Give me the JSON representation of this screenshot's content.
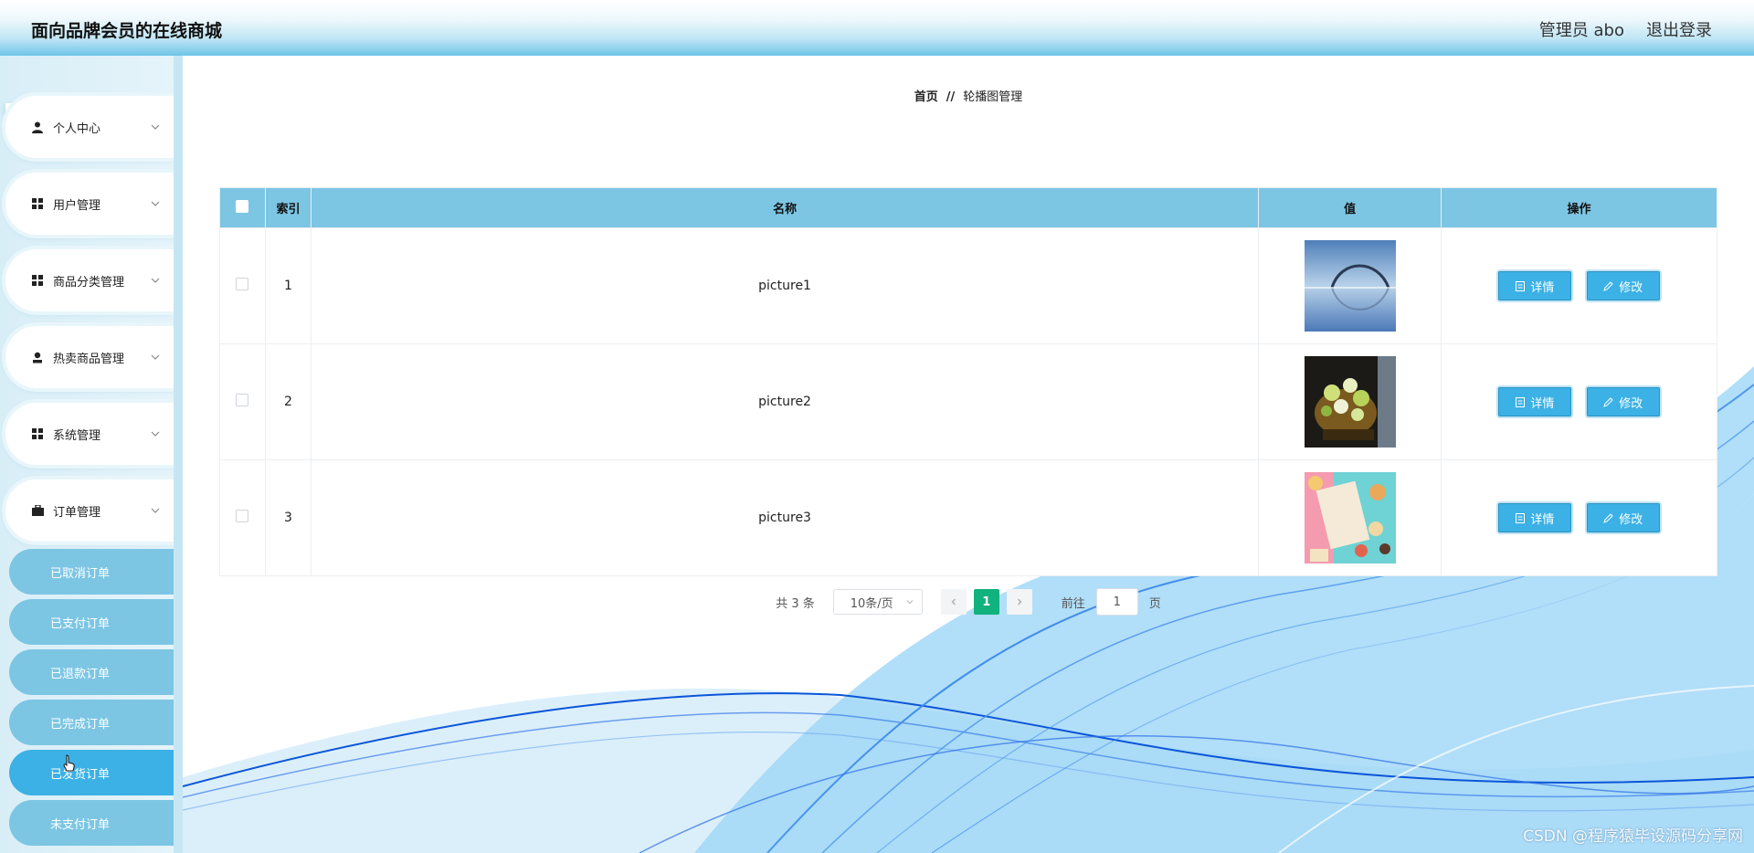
{
  "header": {
    "title": "面向品牌会员的在线商城",
    "admin": "管理员 abo",
    "logout": "退出登录"
  },
  "sidebar": {
    "items": [
      {
        "label": "个人中心",
        "icon": "person-icon"
      },
      {
        "label": "用户管理",
        "icon": "grid-icon"
      },
      {
        "label": "商品分类管理",
        "icon": "grid-icon"
      },
      {
        "label": "热卖商品管理",
        "icon": "user-icon"
      },
      {
        "label": "系统管理",
        "icon": "grid-icon"
      },
      {
        "label": "订单管理",
        "icon": "briefcase-icon"
      }
    ],
    "subitems": [
      "已取消订单",
      "已支付订单",
      "已退款订单",
      "已完成订单",
      "已发货订单",
      "未支付订单"
    ]
  },
  "breadcrumb": {
    "home": "首页",
    "sep": "//",
    "current": "轮播图管理"
  },
  "table": {
    "headers": {
      "index": "索引",
      "name": "名称",
      "value": "值",
      "action": "操作"
    },
    "rows": [
      {
        "index": "1",
        "name": "picture1",
        "detail": "详情",
        "edit": "修改"
      },
      {
        "index": "2",
        "name": "picture2",
        "detail": "详情",
        "edit": "修改"
      },
      {
        "index": "3",
        "name": "picture3",
        "detail": "详情",
        "edit": "修改"
      }
    ]
  },
  "pager": {
    "total": "共 3 条",
    "page_size": "10条/页",
    "current": "1",
    "goto": "前往",
    "goto_value": "1",
    "page_unit": "页"
  },
  "watermark": "CSDN @程序猿毕设源码分享网",
  "colors": {
    "accent": "#3bb1e5",
    "table_header": "#7cc6e4",
    "pager_active": "#11b27d"
  }
}
